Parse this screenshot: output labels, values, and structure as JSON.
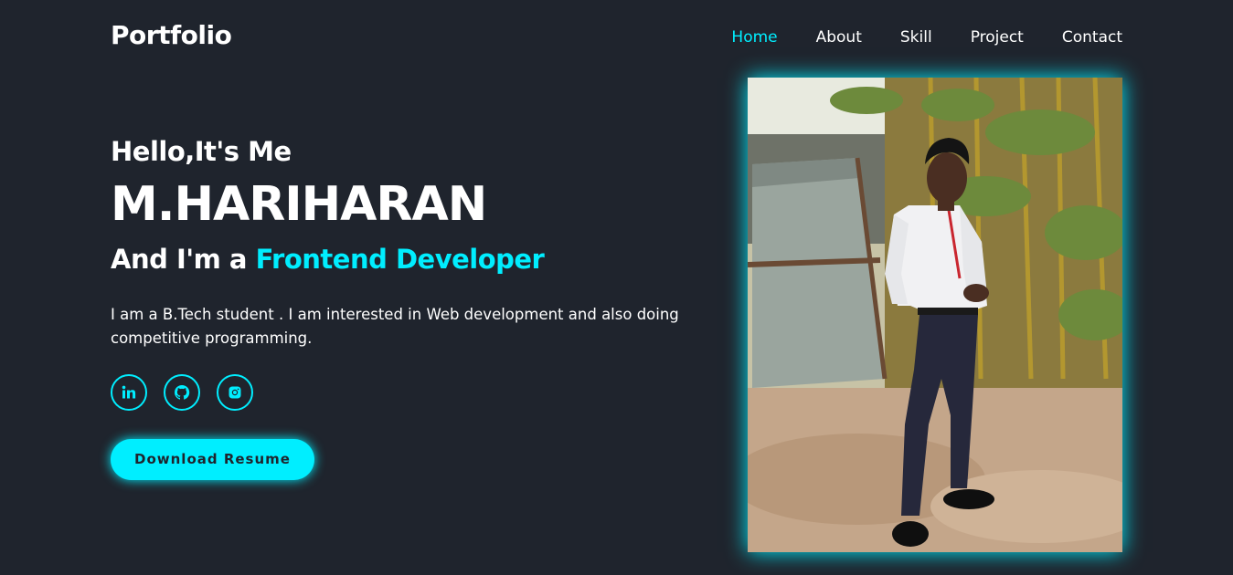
{
  "header": {
    "logo": "Portfolio",
    "nav": [
      {
        "label": "Home",
        "active": true
      },
      {
        "label": "About",
        "active": false
      },
      {
        "label": "Skill",
        "active": false
      },
      {
        "label": "Project",
        "active": false
      },
      {
        "label": "Contact",
        "active": false
      }
    ]
  },
  "hero": {
    "greeting": "Hello,It's Me",
    "name": "M.HARIHARAN",
    "role_prefix": "And I'm a ",
    "role_highlight": "Frontend Developer",
    "bio": "I am a B.Tech student . I am interested in Web development and also doing competitive programming.",
    "socials": [
      {
        "icon": "linkedin-icon"
      },
      {
        "icon": "github-icon"
      },
      {
        "icon": "instagram-icon"
      }
    ],
    "button": "Download Resume"
  },
  "photo": {
    "subject": "profile-photo"
  },
  "colors": {
    "background": "#1f242d",
    "accent": "#00eeff",
    "text": "#ffffff"
  }
}
